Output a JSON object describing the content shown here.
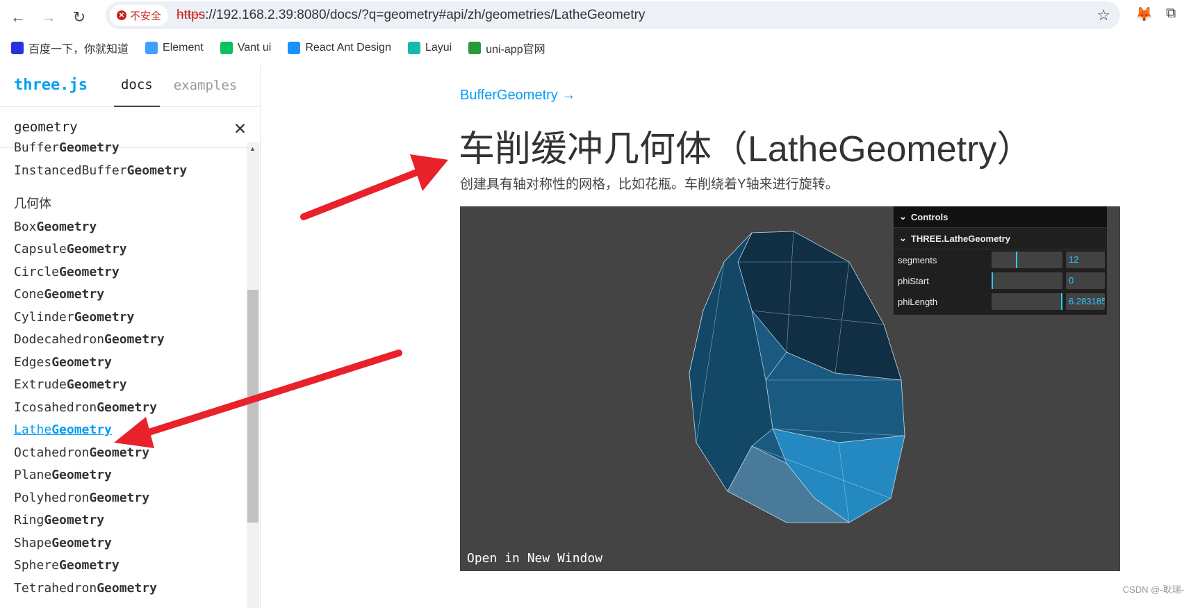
{
  "browser": {
    "security_label": "不安全",
    "url_scheme": "https",
    "url_rest": "://192.168.2.39:8080/docs/?q=geometry#api/zh/geometries/LatheGeometry"
  },
  "bookmarks": [
    {
      "label": "百度一下，你就知道",
      "color": "#2932e1"
    },
    {
      "label": "Element",
      "color": "#409eff"
    },
    {
      "label": "Vant ui",
      "color": "#07c160"
    },
    {
      "label": "React Ant Design",
      "color": "#1890ff"
    },
    {
      "label": "Layui",
      "color": "#16baaa"
    },
    {
      "label": "uni-app官网",
      "color": "#2b9939"
    }
  ],
  "sidebar": {
    "logo": "three.js",
    "tabs": [
      "docs",
      "examples"
    ],
    "search_value": "geometry",
    "items_top": [
      {
        "pre": "Buffer",
        "bold": "Geometry"
      },
      {
        "pre": "InstancedBuffer",
        "bold": "Geometry"
      }
    ],
    "section": "几何体",
    "items": [
      {
        "pre": "Box",
        "bold": "Geometry"
      },
      {
        "pre": "Capsule",
        "bold": "Geometry"
      },
      {
        "pre": "Circle",
        "bold": "Geometry"
      },
      {
        "pre": "Cone",
        "bold": "Geometry"
      },
      {
        "pre": "Cylinder",
        "bold": "Geometry"
      },
      {
        "pre": "Dodecahedron",
        "bold": "Geometry"
      },
      {
        "pre": "Edges",
        "bold": "Geometry"
      },
      {
        "pre": "Extrude",
        "bold": "Geometry"
      },
      {
        "pre": "Icosahedron",
        "bold": "Geometry"
      },
      {
        "pre": "Lathe",
        "bold": "Geometry",
        "active": true
      },
      {
        "pre": "Octahedron",
        "bold": "Geometry"
      },
      {
        "pre": "Plane",
        "bold": "Geometry"
      },
      {
        "pre": "Polyhedron",
        "bold": "Geometry"
      },
      {
        "pre": "Ring",
        "bold": "Geometry"
      },
      {
        "pre": "Shape",
        "bold": "Geometry"
      },
      {
        "pre": "Sphere",
        "bold": "Geometry"
      },
      {
        "pre": "Tetrahedron",
        "bold": "Geometry"
      }
    ]
  },
  "content": {
    "parent_link": "BufferGeometry →",
    "title": "车削缓冲几何体（LatheGeometry）",
    "description": "创建具有轴对称性的网格，比如花瓶。车削绕着Y轴来进行旋转。",
    "open_window": "Open in New Window"
  },
  "controls": {
    "title": "Controls",
    "folder": "THREE.LatheGeometry",
    "params": [
      {
        "label": "segments",
        "value": "12",
        "fraction": 0.35
      },
      {
        "label": "phiStart",
        "value": "0",
        "fraction": 0.0
      },
      {
        "label": "phiLength",
        "value": "6.283185",
        "fraction": 1.0
      }
    ]
  },
  "watermark": "CSDN @-耿瑞-",
  "colors": {
    "accent": "#049ef4",
    "arrow": "#e8212b",
    "mesh": "#1e6a96"
  }
}
